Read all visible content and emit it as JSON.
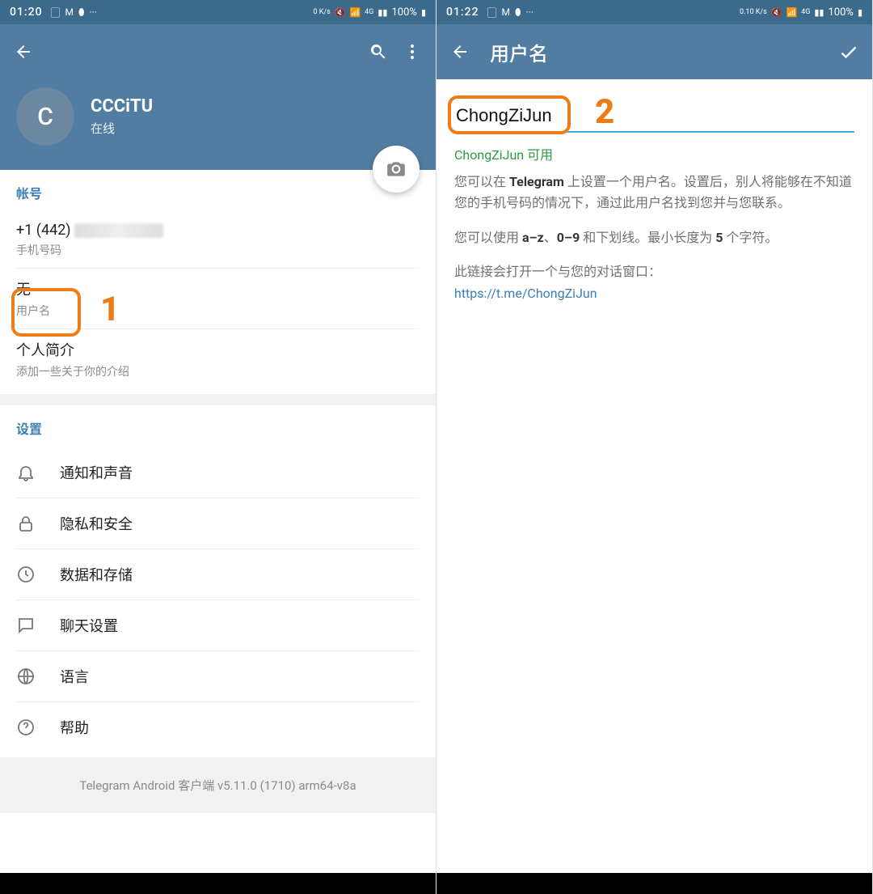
{
  "left": {
    "status": {
      "time": "01:20",
      "speed": "0 K/s",
      "net": "4G",
      "battery": "100%"
    },
    "profile": {
      "avatar_letter": "C",
      "name": "CCCiTU",
      "status": "在线"
    },
    "account": {
      "section_title": "帐号",
      "phone_value": "+1 (442)",
      "phone_label": "手机号码",
      "username_value": "无",
      "username_label": "用户名",
      "bio_title": "个人简介",
      "bio_hint": "添加一些关于你的介绍"
    },
    "settings": {
      "section_title": "设置",
      "items": [
        {
          "label": "通知和声音",
          "icon": "bell-icon"
        },
        {
          "label": "隐私和安全",
          "icon": "lock-icon"
        },
        {
          "label": "数据和存储",
          "icon": "clock-icon"
        },
        {
          "label": "聊天设置",
          "icon": "chat-icon"
        },
        {
          "label": "语言",
          "icon": "globe-icon"
        },
        {
          "label": "帮助",
          "icon": "help-icon"
        }
      ]
    },
    "footer": "Telegram Android 客户端 v5.11.0 (1710) arm64-v8a",
    "annotation_number": "1"
  },
  "right": {
    "status": {
      "time": "01:22",
      "speed": "0.10 K/s",
      "net": "4G",
      "battery": "100%"
    },
    "appbar_title": "用户名",
    "input_value": "ChongZiJun",
    "available_text": "ChongZiJun 可用",
    "desc1_a": "您可以在 ",
    "desc1_b": "Telegram",
    "desc1_c": " 上设置一个用户名。设置后，别人将能够在不知道您的手机号码的情况下，通过此用户名找到您并与您联系。",
    "desc2_a": "您可以使用 ",
    "desc2_b": "a–z",
    "desc2_c": "、",
    "desc2_d": "0–9",
    "desc2_e": " 和下划线。最小长度为 ",
    "desc2_f": "5",
    "desc2_g": " 个字符。",
    "desc3": "此链接会打开一个与您的对话窗口：",
    "link": "https://t.me/ChongZiJun",
    "annotation_number": "2"
  }
}
